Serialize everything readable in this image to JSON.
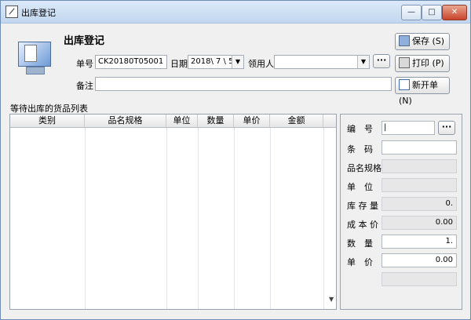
{
  "window": {
    "title": "出库登记",
    "controls": {
      "minimize": "—",
      "maximize": "□",
      "close": "✕"
    }
  },
  "form": {
    "heading": "出库登记",
    "order_no_label": "单号",
    "order_no_value": "CK20180T05001",
    "date_label": "日期",
    "date_value": "2018\\ 7 \\ 5",
    "receiver_label": "领用人",
    "receiver_value": "",
    "remark_label": "备注",
    "remark_value": "",
    "ellipsis": "···"
  },
  "actions": {
    "save": "保存 (S)",
    "print": "打印 (P)",
    "new": "新开单 (N)"
  },
  "list": {
    "caption": "等待出库的货品列表",
    "columns": [
      "类别",
      "品名规格",
      "单位",
      "数量",
      "单价",
      "金额"
    ]
  },
  "detail": {
    "code_label": "编　号",
    "code_value": "|",
    "barcode_label": "条　码",
    "barcode_value": "",
    "spec_label": "品名规格",
    "spec_value": "",
    "unit_label": "单　位",
    "unit_value": "",
    "stock_label": "库 存 量",
    "stock_value": "0.",
    "cost_label": "成 本 价",
    "cost_value": "0.00",
    "qty_label": "数　量",
    "qty_value": "1.",
    "price_label": "单　价",
    "price_value": "0.00"
  },
  "icons": {
    "app": "form-edit-icon",
    "header": "monitor-document-icon",
    "save": "floppy-disk-icon",
    "print": "printer-icon",
    "new": "new-document-icon"
  }
}
